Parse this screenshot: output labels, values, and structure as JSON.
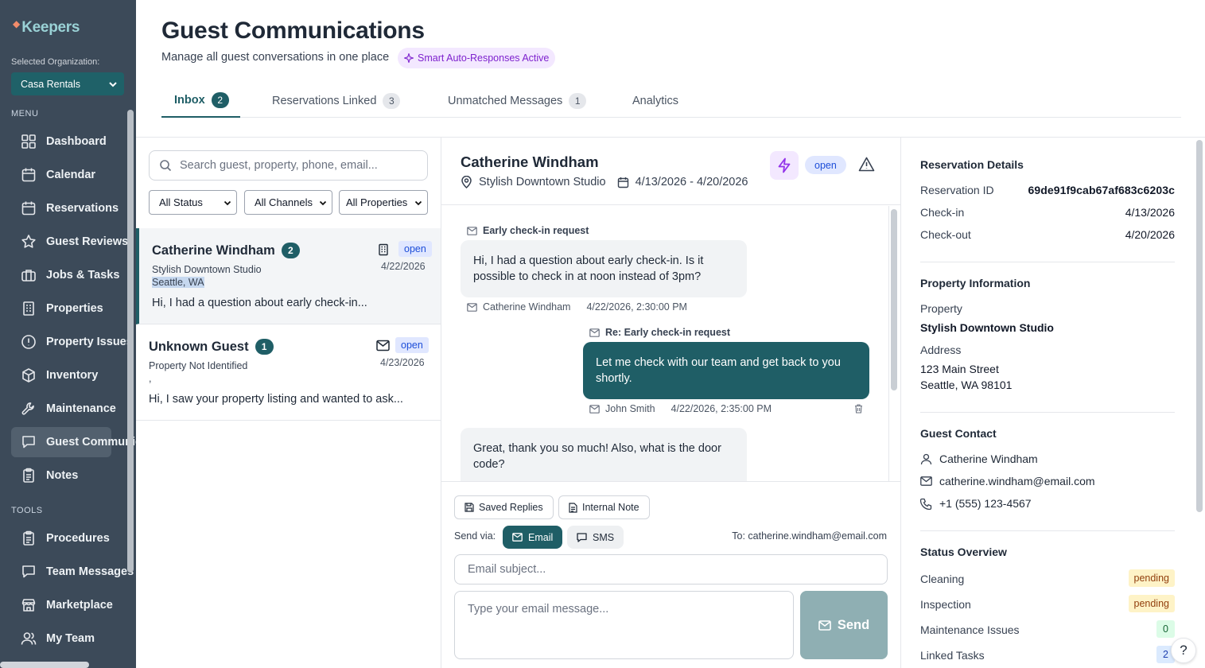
{
  "app": {
    "brand": "Keepers"
  },
  "sidebar": {
    "org_label": "Selected Organization:",
    "org_value": "Casa Rentals",
    "menu_label": "MENU",
    "tools_label": "TOOLS",
    "menu_items": [
      {
        "label": "Dashboard",
        "icon": "grid-icon"
      },
      {
        "label": "Calendar",
        "icon": "calendar-icon"
      },
      {
        "label": "Reservations",
        "icon": "calendar-icon"
      },
      {
        "label": "Guest Reviews",
        "icon": "star-icon"
      },
      {
        "label": "Jobs & Tasks",
        "icon": "briefcase-icon"
      },
      {
        "label": "Properties",
        "icon": "building-icon"
      },
      {
        "label": "Property Issues",
        "icon": "alert-circle-icon"
      },
      {
        "label": "Inventory",
        "icon": "package-icon"
      },
      {
        "label": "Maintenance",
        "icon": "wrench-icon"
      },
      {
        "label": "Guest Communications",
        "icon": "message-icon"
      },
      {
        "label": "Notes",
        "icon": "clipboard-icon"
      }
    ],
    "tool_items": [
      {
        "label": "Procedures",
        "icon": "clipboard-icon"
      },
      {
        "label": "Team Messages",
        "icon": "message-icon"
      },
      {
        "label": "Marketplace",
        "icon": "store-icon"
      },
      {
        "label": "My Team",
        "icon": "users-icon"
      }
    ]
  },
  "header": {
    "title": "Guest Communications",
    "subtitle": "Manage all guest conversations in one place",
    "badge": "Smart Auto-Responses Active"
  },
  "tabs": [
    {
      "label": "Inbox",
      "count": "2",
      "active": true
    },
    {
      "label": "Reservations Linked",
      "count": "3"
    },
    {
      "label": "Unmatched Messages",
      "count": "1"
    },
    {
      "label": "Analytics",
      "count": ""
    }
  ],
  "list": {
    "search_placeholder": "Search guest, property, phone, email...",
    "filters": [
      "All Status",
      "All Channels",
      "All Properties"
    ],
    "conversations": [
      {
        "name": "Catherine Windham",
        "count": "2",
        "property": "Stylish Downtown Studio",
        "location": "Seattle, WA",
        "status": "open",
        "date": "4/22/2026",
        "preview": "Hi, I had a question about early check-in...",
        "channel_icon": "building-icon"
      },
      {
        "name": "Unknown Guest",
        "count": "1",
        "property": "Property Not Identified",
        "location": ",",
        "status": "open",
        "date": "4/23/2026",
        "preview": "Hi, I saw your property listing and wanted to ask...",
        "channel_icon": "mail-icon"
      }
    ]
  },
  "chat": {
    "guest_name": "Catherine Windham",
    "property": "Stylish Downtown Studio",
    "dates": "4/13/2026 - 4/20/2026",
    "status": "open",
    "messages": [
      {
        "subject": "Early check-in request",
        "body": "Hi, I had a question about early check-in. Is it possible to check in at noon instead of 3pm?",
        "sender": "Catherine Windham",
        "time": "4/22/2026, 2:30:00 PM",
        "direction": "in"
      },
      {
        "subject": "Re: Early check-in request",
        "body": "Let me check with our team and get back to you shortly.",
        "sender": "John Smith",
        "time": "4/22/2026, 2:35:00 PM",
        "direction": "out"
      },
      {
        "subject": "",
        "body": "Great, thank you so much! Also, what is the door code?",
        "sender": "",
        "time": "",
        "direction": "in"
      }
    ],
    "composer": {
      "saved_replies": "Saved Replies",
      "internal_note": "Internal Note",
      "send_via_label": "Send via:",
      "email_label": "Email",
      "sms_label": "SMS",
      "to_line": "To: catherine.windham@email.com",
      "subject_placeholder": "Email subject...",
      "body_placeholder": "Type your email message...",
      "send_label": "Send"
    }
  },
  "details": {
    "reservation": {
      "title": "Reservation Details",
      "id_label": "Reservation ID",
      "id_value": "69de91f9cab67af683c6203c",
      "checkin_label": "Check-in",
      "checkin_value": "4/13/2026",
      "checkout_label": "Check-out",
      "checkout_value": "4/20/2026"
    },
    "property": {
      "title": "Property Information",
      "property_label": "Property",
      "property_value": "Stylish Downtown Studio",
      "address_label": "Address",
      "address_line1": "123 Main Street",
      "address_line2": "Seattle, WA 98101"
    },
    "contact": {
      "title": "Guest Contact",
      "name": "Catherine Windham",
      "email": "catherine.windham@email.com",
      "phone": "+1 (555) 123-4567"
    },
    "status": {
      "title": "Status Overview",
      "items": [
        {
          "label": "Cleaning",
          "value": "pending"
        },
        {
          "label": "Inspection",
          "value": "pending"
        },
        {
          "label": "Maintenance Issues",
          "value": "0"
        },
        {
          "label": "Linked Tasks",
          "value": "2"
        }
      ]
    }
  },
  "help_label": "?",
  "colors": {
    "sidebar_bg": "#3c4a59",
    "accent": "#1f5e66",
    "smart_badge": "#7e22ce",
    "status_open_bg": "#e0e7ff",
    "pending_bg": "#fef3c7"
  }
}
